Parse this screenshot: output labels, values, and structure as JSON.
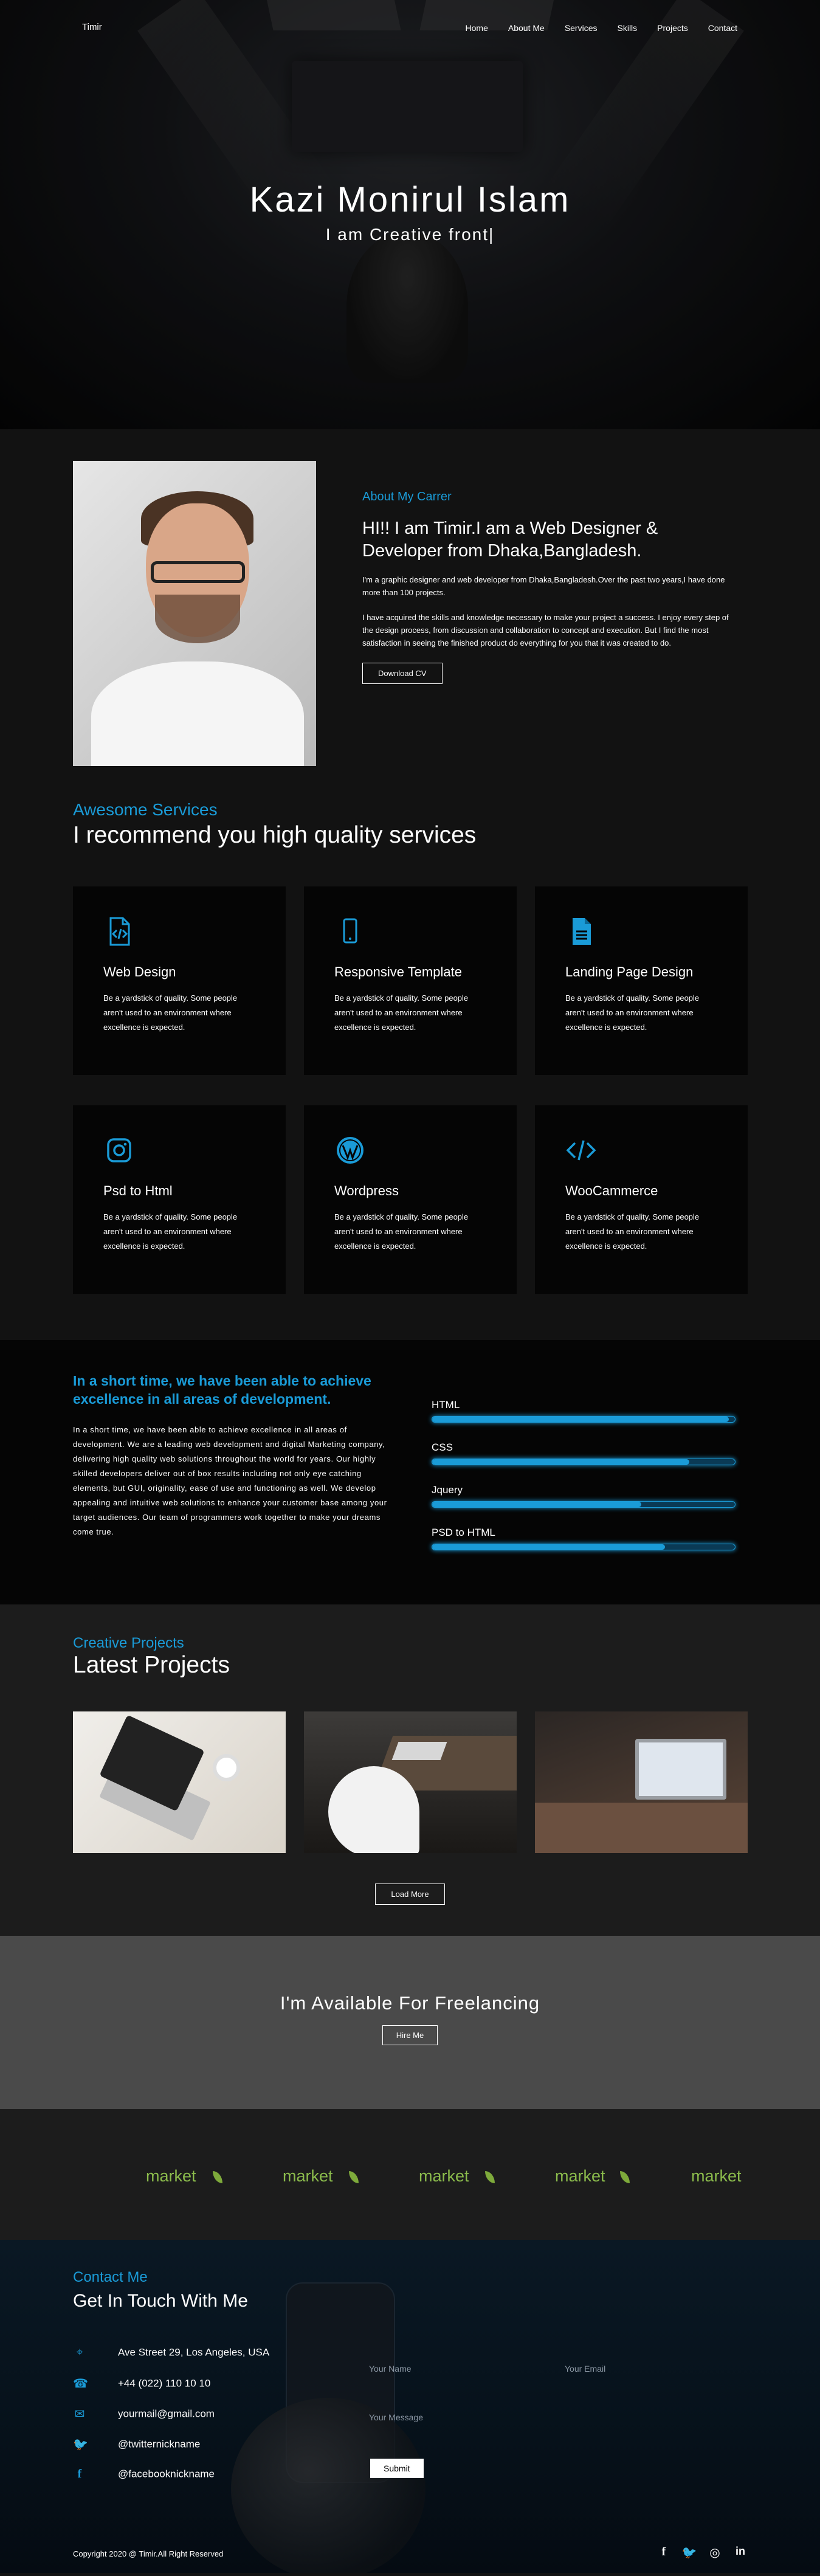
{
  "nav": {
    "logo": "Timir",
    "items": [
      "Home",
      "About Me",
      "Services",
      "Skills",
      "Projects",
      "Contact"
    ]
  },
  "hero": {
    "name": "Kazi Monirul Islam",
    "tagline": "I am Creative front|"
  },
  "about": {
    "subtitle": "About My Carrer",
    "heading": "HI!! I am Timir.I am a Web Designer & Developer from Dhaka,Bangladesh.",
    "para1": "I'm a graphic designer and web developer from Dhaka,Bangladesh.Over the past two years,I have done more than 100 projects.",
    "para2": "I have acquired the skills and knowledge necessary to make your project a success. I enjoy every step of the design process, from discussion and collaboration to concept and execution. But I find the most satisfaction in seeing the finished product do everything for you that it was created to do.",
    "button": "Download CV"
  },
  "services": {
    "subtitle": "Awesome Services",
    "title": "I recommend you high quality services",
    "items": [
      {
        "icon": "code-file-icon",
        "title": "Web Design",
        "text": "Be a yardstick of quality. Some people aren't used to an environment where excellence is expected."
      },
      {
        "icon": "mobile-icon",
        "title": "Responsive Template",
        "text": "Be a yardstick of quality. Some people aren't used to an environment where excellence is expected."
      },
      {
        "icon": "document-icon",
        "title": "Landing Page Design",
        "text": "Be a yardstick of quality. Some people aren't used to an environment where excellence is expected."
      },
      {
        "icon": "instagram-icon",
        "title": "Psd to Html",
        "text": "Be a yardstick of quality. Some people aren't used to an environment where excellence is expected."
      },
      {
        "icon": "wordpress-icon",
        "title": "Wordpress",
        "text": "Be a yardstick of quality. Some people aren't used to an environment where excellence is expected."
      },
      {
        "icon": "code-icon",
        "title": "WooCammerce",
        "text": "Be a yardstick of quality. Some people aren't used to an environment where excellence is expected."
      }
    ]
  },
  "skills": {
    "heading": "In a short time, we have been able to achieve excellence in all areas of development.",
    "text": "In a short time, we have been able to achieve excellence in all areas of development. We are a leading web development and digital Marketing company, delivering high quality web solutions throughout the world for years. Our highly skilled developers deliver out of box results including not only eye catching elements, but GUI, originality, ease of use and functioning as well. We develop appealing and intuitive web solutions to enhance your customer base among your target audiences. Our team of programmers work together to make your dreams come true.",
    "items": [
      {
        "label": "HTML",
        "percent": 98
      },
      {
        "label": "CSS",
        "percent": 85
      },
      {
        "label": "Jquery",
        "percent": 69
      },
      {
        "label": "PSD to HTML",
        "percent": 77
      }
    ],
    "accent": "#1a9bd7"
  },
  "projects": {
    "subtitle": "Creative Projects",
    "title": "Latest Projects",
    "button": "Load More"
  },
  "freelance": {
    "title": "I'm Available For Freelancing",
    "button": "Hire Me"
  },
  "brands": [
    "market",
    "market",
    "market",
    "market",
    "market"
  ],
  "contact": {
    "subtitle": "Contact Me",
    "title": "Get In Touch With Me",
    "items": [
      {
        "icon": "location-icon",
        "text": "Ave Street 29, Los Angeles, USA"
      },
      {
        "icon": "phone-icon",
        "text": "+44 (022) 110 10 10"
      },
      {
        "icon": "mail-icon",
        "text": "yourmail@gmail.com"
      },
      {
        "icon": "twitter-icon",
        "text": "@twitternickname"
      },
      {
        "icon": "facebook-icon",
        "text": "@facebooknickname"
      }
    ],
    "name_placeholder": "Your Name",
    "email_placeholder": "Your Email",
    "message_placeholder": "Your Message",
    "submit": "Submit"
  },
  "footer": {
    "copyright": "Copyright 2020 @ Timir.All Right Reserved",
    "social": [
      "facebook-icon",
      "twitter-icon",
      "instagram-icon",
      "linkedin-icon"
    ]
  }
}
